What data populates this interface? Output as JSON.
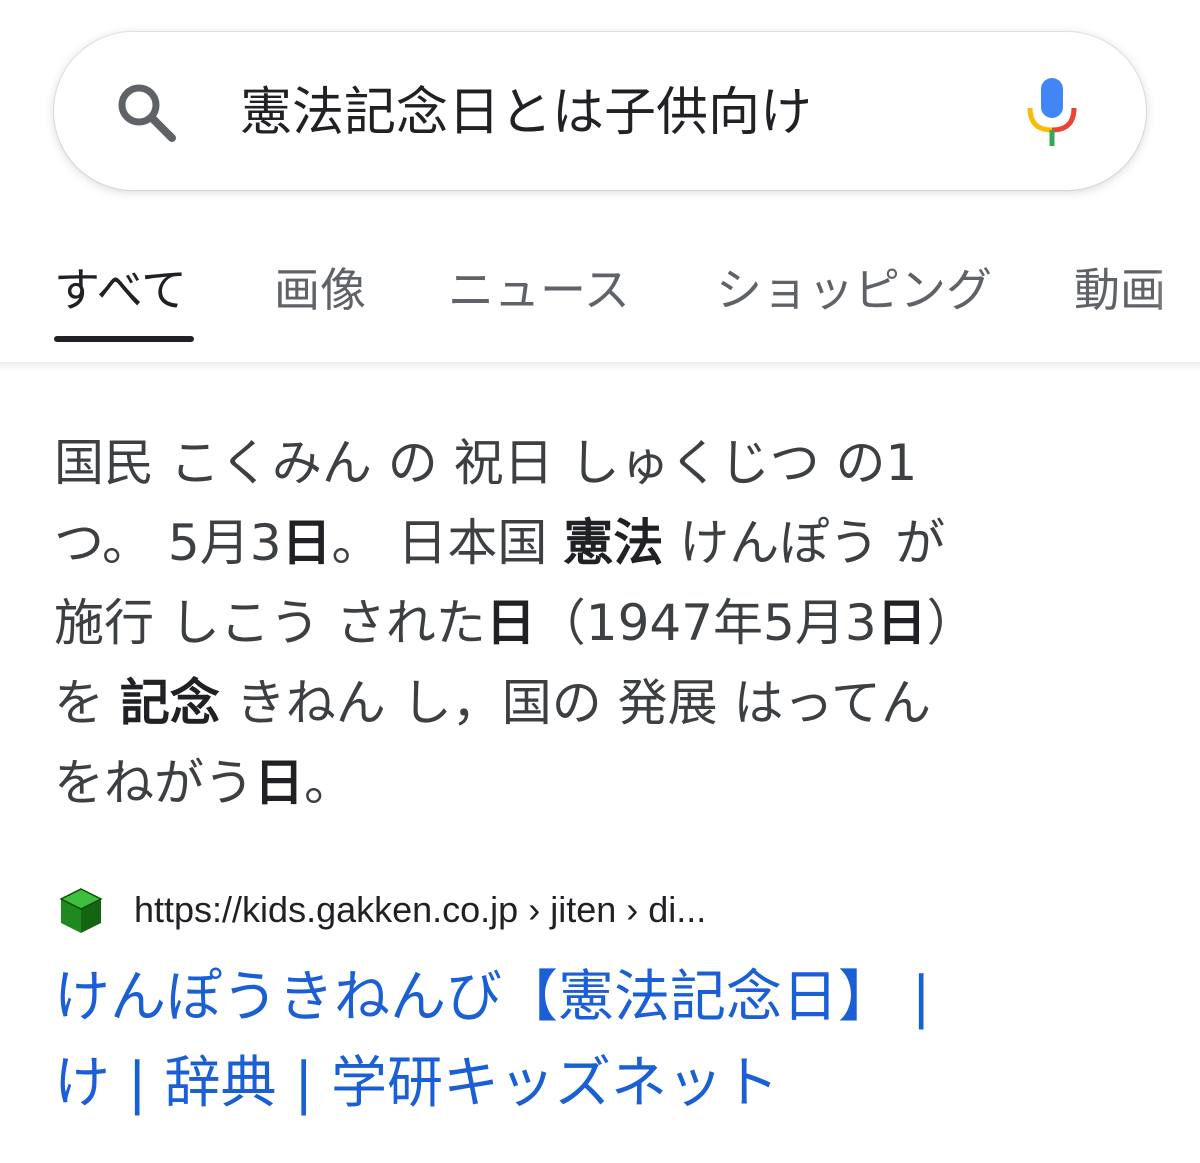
{
  "search": {
    "query": "憲法記念日とは子供向け"
  },
  "tabs": [
    "すべて",
    "画像",
    "ニュース",
    "ショッピング",
    "動画"
  ],
  "snippet": {
    "lines": [
      [
        {
          "t": "国民 こくみん の 祝日 しゅくじつ の1",
          "b": false
        }
      ],
      [
        {
          "t": "つ。 5月3",
          "b": false
        },
        {
          "t": "日",
          "b": true
        },
        {
          "t": "。 日本国 ",
          "b": false
        },
        {
          "t": "憲法",
          "b": true
        },
        {
          "t": " けんぽう が",
          "b": false
        }
      ],
      [
        {
          "t": "施行 しこう された",
          "b": false
        },
        {
          "t": "日",
          "b": true
        },
        {
          "t": "（1947年5月3",
          "b": false
        },
        {
          "t": "日",
          "b": true
        },
        {
          "t": "）",
          "b": false
        }
      ],
      [
        {
          "t": "を ",
          "b": false
        },
        {
          "t": "記念",
          "b": true
        },
        {
          "t": " きねん し，国の 発展 はってん",
          "b": false
        }
      ],
      [
        {
          "t": "をねがう",
          "b": false
        },
        {
          "t": "日",
          "b": true
        },
        {
          "t": "。",
          "b": false
        }
      ]
    ]
  },
  "result": {
    "url": "https://kids.gakken.co.jp › jiten › di...",
    "title_lines": [
      "けんぽうきねんび【憲法記念日】 |",
      "け | 辞典 | 学研キッズネット"
    ]
  },
  "colors": {
    "link": "#1a5fd3",
    "text": "#3c4043",
    "active_tab": "#202124",
    "inactive_tab": "#5f6368"
  }
}
